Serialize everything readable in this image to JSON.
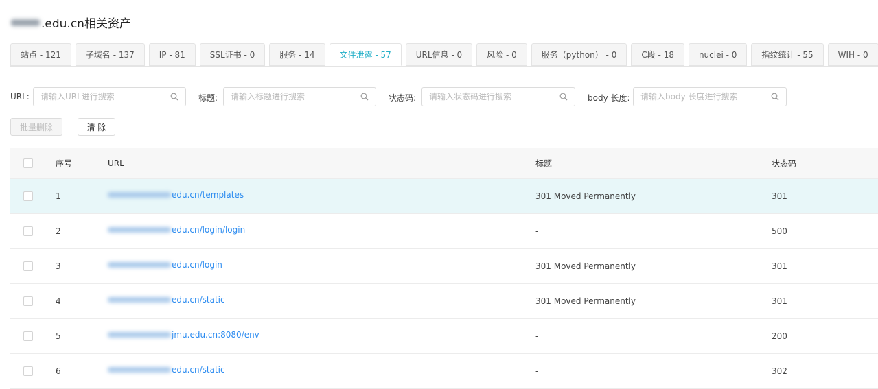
{
  "page": {
    "title": ".edu.cn相关资产"
  },
  "tabs": [
    {
      "label": "站点 - 121",
      "active": false
    },
    {
      "label": "子域名 - 137",
      "active": false
    },
    {
      "label": "IP - 81",
      "active": false
    },
    {
      "label": "SSL证书 - 0",
      "active": false
    },
    {
      "label": "服务 - 14",
      "active": false
    },
    {
      "label": "文件泄露 - 57",
      "active": true
    },
    {
      "label": "URL信息 - 0",
      "active": false
    },
    {
      "label": "风险 - 0",
      "active": false
    },
    {
      "label": "服务（python） - 0",
      "active": false
    },
    {
      "label": "C段 - 18",
      "active": false
    },
    {
      "label": "nuclei - 0",
      "active": false
    },
    {
      "label": "指纹统计 - 55",
      "active": false
    },
    {
      "label": "WIH - 0",
      "active": false
    }
  ],
  "filters": {
    "url": {
      "label": "URL:",
      "placeholder": "请输入URL进行搜索"
    },
    "title": {
      "label": "标题:",
      "placeholder": "请输入标题进行搜索"
    },
    "status": {
      "label": "状态码:",
      "placeholder": "请输入状态码进行搜索"
    },
    "body": {
      "label": "body 长度:",
      "placeholder": "请输入body 长度进行搜索"
    }
  },
  "actions": {
    "batch_delete": "批量删除",
    "clear": "清 除"
  },
  "table": {
    "headers": {
      "index": "序号",
      "url": "URL",
      "title": "标题",
      "status": "状态码"
    },
    "rows": [
      {
        "index": "1",
        "url": "edu.cn/templates",
        "title": "301 Moved Permanently",
        "status": "301",
        "highlighted": true
      },
      {
        "index": "2",
        "url": "edu.cn/login/login",
        "title": "-",
        "status": "500",
        "highlighted": false
      },
      {
        "index": "3",
        "url": "edu.cn/login",
        "title": "301 Moved Permanently",
        "status": "301",
        "highlighted": false
      },
      {
        "index": "4",
        "url": "edu.cn/static",
        "title": "301 Moved Permanently",
        "status": "301",
        "highlighted": false
      },
      {
        "index": "5",
        "url": "jmu.edu.cn:8080/env",
        "title": "-",
        "status": "200",
        "highlighted": false
      },
      {
        "index": "6",
        "url": "edu.cn/static",
        "title": "-",
        "status": "302",
        "highlighted": false
      }
    ]
  },
  "colors": {
    "accent": "#25b0c8",
    "link": "#2d8cf0",
    "highlight_row": "#e8f7f9"
  },
  "icons": {
    "search": "search-icon",
    "checkbox": "checkbox-icon"
  }
}
